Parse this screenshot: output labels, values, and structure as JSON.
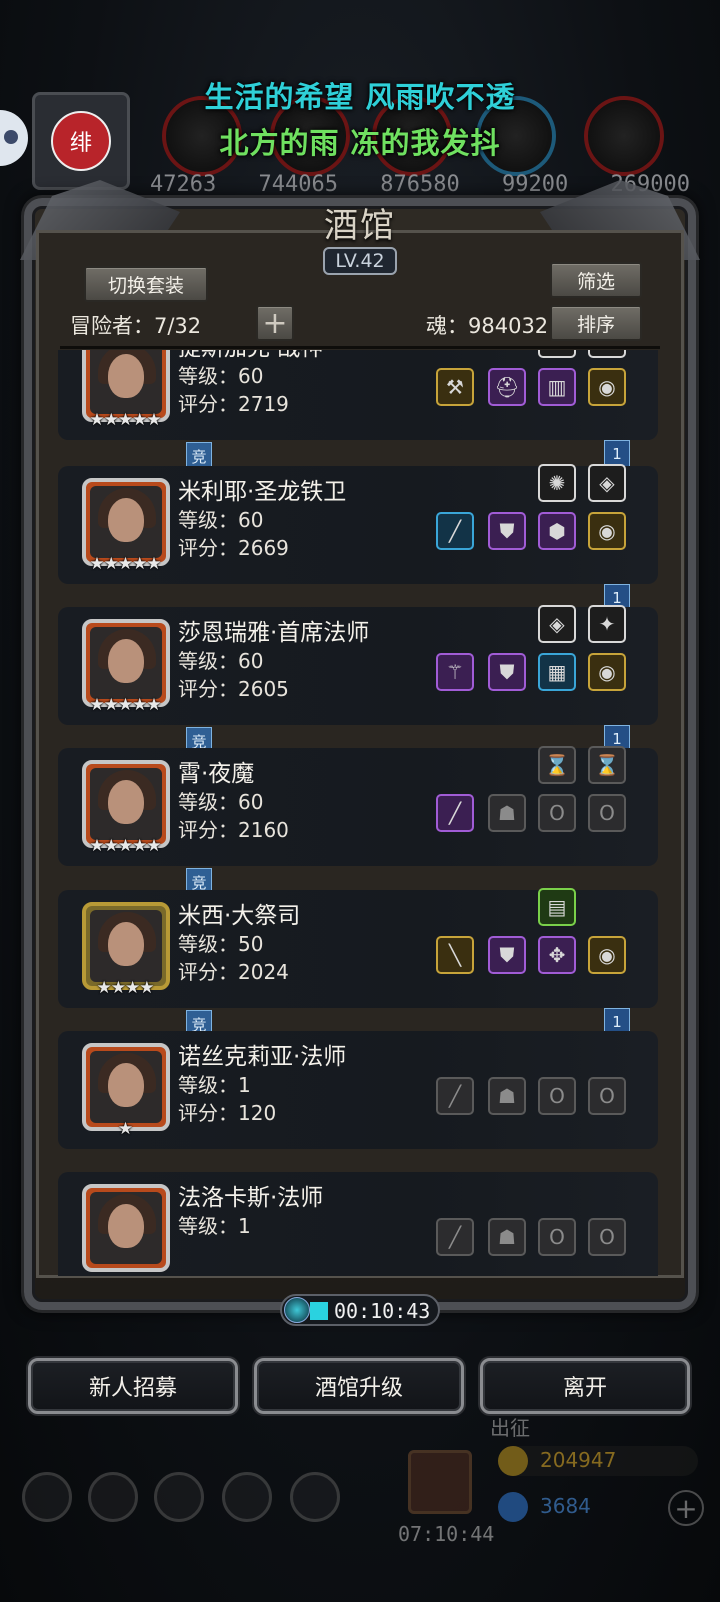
{
  "lyrics": {
    "line1": "生活的希望 风雨吹不透",
    "line2": "北方的雨 冻的我发抖"
  },
  "top_bar": {
    "avatar_glyph": "绯",
    "resources": [
      "47263",
      "744065",
      "876580",
      "99200",
      "269000"
    ]
  },
  "tavern": {
    "title": "酒馆",
    "level": "LV.42",
    "switch_outfit_label": "切换套装",
    "filter_label": "筛选",
    "sort_label": "排序",
    "adventurer_count": "冒险者：7/32",
    "add_label": "+",
    "soul": "魂：984032"
  },
  "heroes": [
    {
      "name": "提斯加克·战神",
      "level": "等级：60",
      "score": "评分：2719",
      "stars": "★★★★★",
      "frame": "silver",
      "top_slots": [
        {
          "c": "white",
          "g": "◐"
        },
        {
          "c": "white",
          "g": "✎"
        }
      ],
      "bottom_slots": [
        {
          "c": "gold",
          "g": "⚒"
        },
        {
          "c": "purple",
          "g": "⛑"
        },
        {
          "c": "purple",
          "g": "▥"
        },
        {
          "c": "gold",
          "g": "◉"
        }
      ],
      "jing": "竞",
      "one": "1"
    },
    {
      "name": "米利耶·圣龙铁卫",
      "level": "等级：60",
      "score": "评分：2669",
      "stars": "★★★★★",
      "frame": "silver",
      "top_slots": [
        {
          "c": "white",
          "g": "✺"
        },
        {
          "c": "white",
          "g": "◈"
        }
      ],
      "bottom_slots": [
        {
          "c": "blue",
          "g": "╱"
        },
        {
          "c": "purple",
          "g": "⛊"
        },
        {
          "c": "purple",
          "g": "⬢"
        },
        {
          "c": "gold",
          "g": "◉"
        }
      ],
      "jing": "",
      "one": "1"
    },
    {
      "name": "莎恩瑞雅·首席法师",
      "level": "等级：60",
      "score": "评分：2605",
      "stars": "★★★★★",
      "frame": "silver",
      "top_slots": [
        {
          "c": "white",
          "g": "◈"
        },
        {
          "c": "white",
          "g": "✦"
        }
      ],
      "bottom_slots": [
        {
          "c": "purple",
          "g": "⚚"
        },
        {
          "c": "purple",
          "g": "⛊"
        },
        {
          "c": "blue",
          "g": "▦"
        },
        {
          "c": "gold",
          "g": "◉"
        }
      ],
      "jing": "竞",
      "one": "1"
    },
    {
      "name": "霄·夜魔",
      "level": "等级：60",
      "score": "评分：2160",
      "stars": "★★★★★",
      "frame": "silver",
      "top_slots": [
        {
          "c": "empty",
          "g": "⌛"
        },
        {
          "c": "empty",
          "g": "⌛"
        }
      ],
      "bottom_slots": [
        {
          "c": "purple",
          "g": "╱"
        },
        {
          "c": "empty",
          "g": "☗"
        },
        {
          "c": "empty",
          "g": "O"
        },
        {
          "c": "empty",
          "g": "O"
        }
      ],
      "jing": "竞",
      "one": ""
    },
    {
      "name": "米西·大祭司",
      "level": "等级：50",
      "score": "评分：2024",
      "stars": "★★★★",
      "frame": "gold",
      "top_slots": [
        {
          "c": "green",
          "g": "▤"
        }
      ],
      "bottom_slots": [
        {
          "c": "gold",
          "g": "╲"
        },
        {
          "c": "purple",
          "g": "⛊"
        },
        {
          "c": "purple",
          "g": "✥"
        },
        {
          "c": "gold",
          "g": "◉"
        }
      ],
      "jing": "竞",
      "one": "1"
    },
    {
      "name": "诺丝克莉亚·法师",
      "level": "等级：1",
      "score": "评分：120",
      "stars": "★",
      "frame": "silver",
      "top_slots": [],
      "bottom_slots": [
        {
          "c": "empty",
          "g": "╱"
        },
        {
          "c": "empty",
          "g": "☗"
        },
        {
          "c": "empty",
          "g": "O"
        },
        {
          "c": "empty",
          "g": "O"
        }
      ],
      "jing": "",
      "one": ""
    },
    {
      "name": "法洛卡斯·法师",
      "level": "等级：1",
      "score": "",
      "stars": "",
      "frame": "silver",
      "top_slots": [],
      "bottom_slots": [
        {
          "c": "empty",
          "g": "╱"
        },
        {
          "c": "empty",
          "g": "☗"
        },
        {
          "c": "empty",
          "g": "O"
        },
        {
          "c": "empty",
          "g": "O"
        }
      ],
      "jing": "",
      "one": ""
    }
  ],
  "timer": {
    "text": "00:10:43"
  },
  "actions": {
    "recruit": "新人招募",
    "upgrade": "酒馆升级",
    "leave": "离开"
  },
  "hud": {
    "expedition": "出征",
    "gold": "204947",
    "gems": "3684",
    "chest_timer": "07:10:44"
  }
}
